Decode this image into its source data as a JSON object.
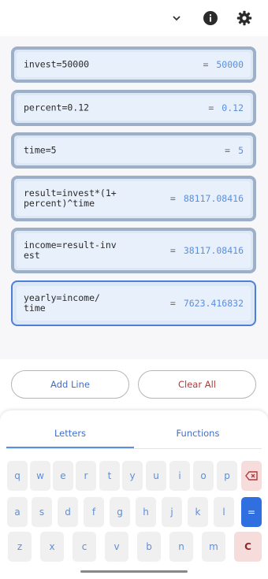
{
  "topbar": {
    "icons": [
      "chevron-down-icon",
      "info-icon",
      "settings-icon"
    ]
  },
  "lines": [
    {
      "expr": "invest=50000",
      "result": "50000"
    },
    {
      "expr": "percent=0.12",
      "result": "0.12"
    },
    {
      "expr": "time=5",
      "result": "5"
    },
    {
      "expr": "result=invest*(1+\npercent)^time",
      "result": "88117.08416"
    },
    {
      "expr": "income=result-inv\nest",
      "result": "38117.08416"
    },
    {
      "expr": "yearly=income/\ntime",
      "result": "7623.416832"
    }
  ],
  "equals_sign": "=",
  "actions": {
    "add_line": "Add Line",
    "clear_all": "Clear All"
  },
  "keyboard": {
    "tabs": [
      "Letters",
      "Functions"
    ],
    "active_tab": "Letters",
    "row1": [
      "q",
      "w",
      "e",
      "r",
      "t",
      "y",
      "u",
      "i",
      "o",
      "p"
    ],
    "row2": [
      "a",
      "s",
      "d",
      "f",
      "g",
      "h",
      "j",
      "k",
      "l"
    ],
    "row3": [
      "z",
      "x",
      "c",
      "v",
      "b",
      "n",
      "m"
    ],
    "backspace_icon": "backspace-icon",
    "enter_label": "=",
    "clear_label": "C"
  },
  "colors": {
    "accent": "#5b8fe0",
    "danger": "#b23a3a",
    "line_bg": "#e8f0fb"
  }
}
